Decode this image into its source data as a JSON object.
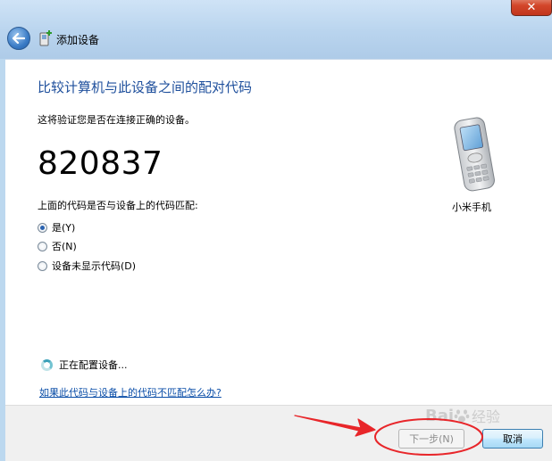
{
  "window": {
    "title": "添加设备",
    "close_label": "✕"
  },
  "main": {
    "heading": "比较计算机与此设备之间的配对代码",
    "verify_text": "这将验证您是否在连接正确的设备。",
    "code": "820837",
    "question": "上面的代码是否与设备上的代码匹配:",
    "options": [
      {
        "label": "是(Y)",
        "selected": true
      },
      {
        "label": "否(N)",
        "selected": false
      },
      {
        "label": "设备未显示代码(D)",
        "selected": false
      }
    ],
    "device_name": "小米手机",
    "status": "正在配置设备...",
    "help_link": "如果此代码与设备上的代码不匹配怎么办?"
  },
  "footer": {
    "next_label": "下一步(N)",
    "cancel_label": "取消"
  },
  "watermark": {
    "text": "Bai",
    "sub": "经验"
  },
  "colors": {
    "heading": "#1e4f9c",
    "link": "#0b4ea8",
    "annotation_red": "#e8262a"
  },
  "icons": [
    "back-arrow-icon",
    "bluetooth-device-icon",
    "mobile-phone-icon",
    "loading-spinner-icon",
    "paw-icon"
  ]
}
